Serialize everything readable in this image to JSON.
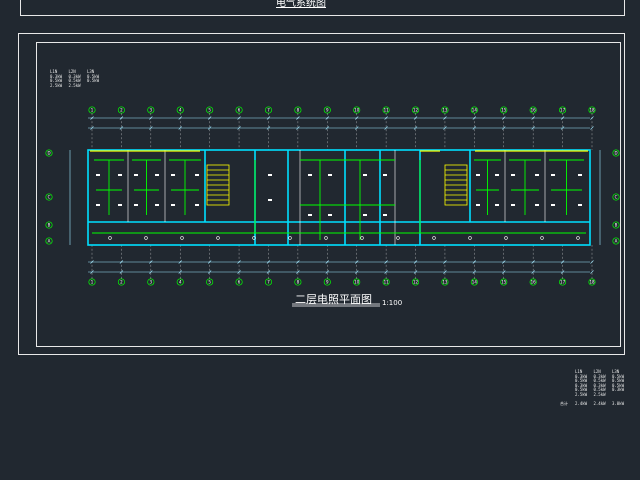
{
  "drawing": {
    "top_title": "电气系统图",
    "main_title": "二层电照平面图",
    "scale": "1:100"
  },
  "top_left_legend": {
    "columns": [
      [
        "L1N",
        "0.3kW",
        "0.5kW",
        "2.5kW"
      ],
      [
        "L2N",
        "0.3kW",
        "0.5kW",
        "2.5kW"
      ],
      [
        "L3N",
        "0.5kW",
        "0.5kW"
      ]
    ]
  },
  "bottom_right_legend": {
    "columns": [
      [
        "L1N",
        "0.3kW",
        "0.5kW",
        "0.3kW",
        "0.5kW",
        "2.5kW",
        "",
        "2.4kW"
      ],
      [
        "L2N",
        "0.3kW",
        "0.5kW",
        "0.3kW",
        "0.5kW",
        "2.5kW",
        "",
        "2.4kW"
      ],
      [
        "L3N",
        "0.5kW",
        "0.5kW",
        "0.5kW",
        "0.3kW",
        "",
        "",
        "3.0kW"
      ]
    ],
    "total_label": "合计"
  },
  "axis_labels": {
    "top": [
      "1",
      "2",
      "3",
      "4",
      "5",
      "6",
      "7",
      "8",
      "9",
      "10",
      "11",
      "12",
      "13",
      "14",
      "15",
      "16",
      "17",
      "18"
    ],
    "left": [
      "D",
      "C",
      "B",
      "A"
    ]
  },
  "colors": {
    "background": "#212830",
    "frame": "#e8e8e8",
    "wall": "#00e0ff",
    "wiring": "#00ff00",
    "dimension": "#9fe8ff",
    "grid_line": "#ffffff",
    "stair": "#ffff00"
  }
}
